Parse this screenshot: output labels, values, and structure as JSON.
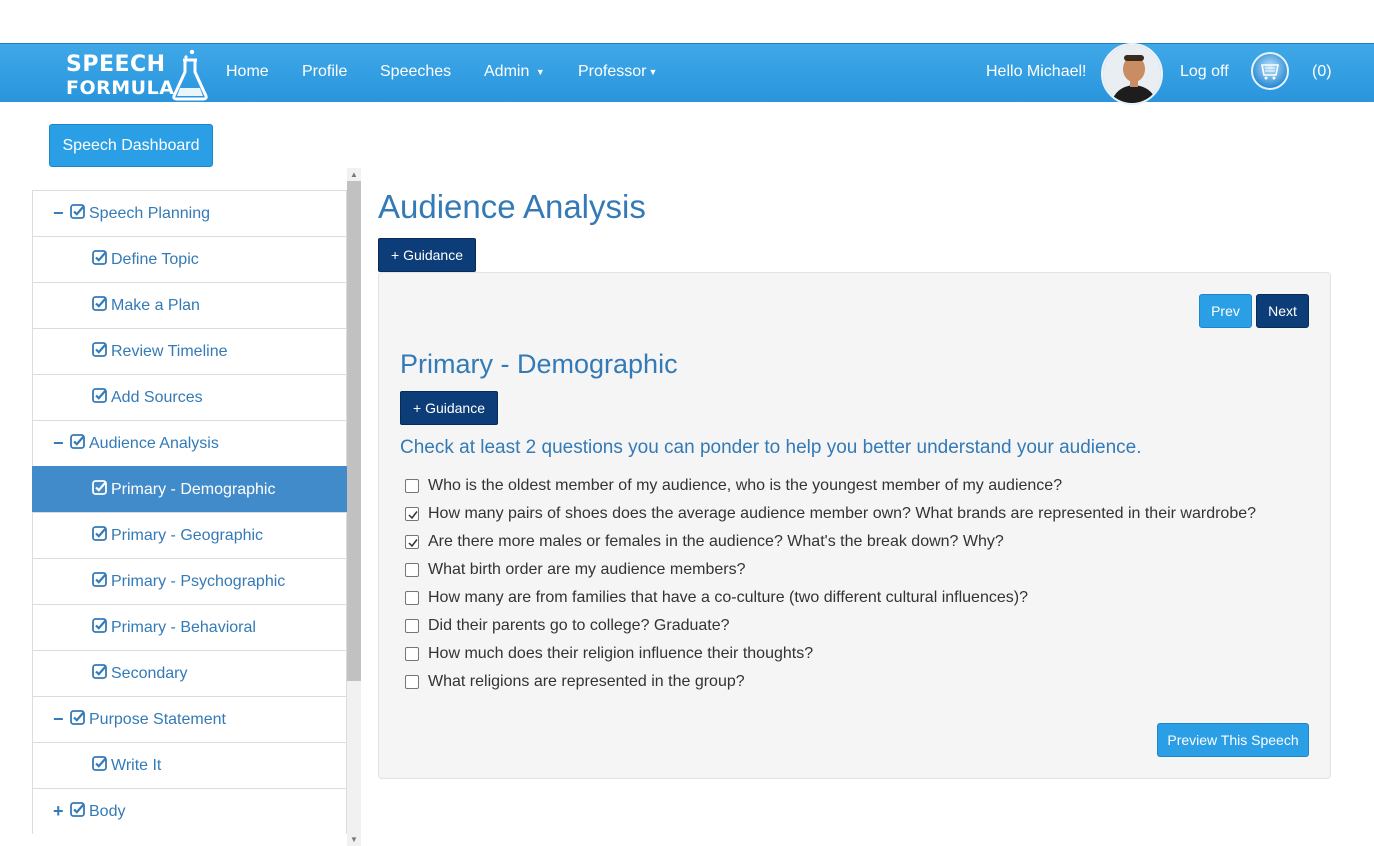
{
  "navbar": {
    "logo_line1": "SPEECH",
    "logo_line2": "FORMULA",
    "links": [
      "Home",
      "Profile",
      "Speeches",
      "Admin",
      "Professor"
    ],
    "greeting": "Hello Michael!",
    "logoff": "Log off",
    "cart_count": "(0)"
  },
  "dashboard_button": "Speech Dashboard",
  "sidebar": {
    "items": [
      {
        "label": "Speech Planning",
        "toggle": "−"
      },
      {
        "label": "Define Topic"
      },
      {
        "label": "Make a Plan"
      },
      {
        "label": "Review Timeline"
      },
      {
        "label": "Add Sources"
      },
      {
        "label": "Audience Analysis",
        "toggle": "−"
      },
      {
        "label": "Primary - Demographic",
        "active": true
      },
      {
        "label": "Primary - Geographic"
      },
      {
        "label": "Primary - Psychographic"
      },
      {
        "label": "Primary - Behavioral"
      },
      {
        "label": "Secondary"
      },
      {
        "label": "Purpose Statement",
        "toggle": "−"
      },
      {
        "label": "Write It"
      },
      {
        "label": "Body",
        "toggle": "+"
      }
    ]
  },
  "main": {
    "title": "Audience Analysis",
    "guidance_label": "+ Guidance",
    "prev_label": "Prev",
    "next_label": "Next",
    "section_title": "Primary - Demographic",
    "section_guidance_label": "+ Guidance",
    "instruction": "Check at least 2 questions you can ponder to help you better understand your audience.",
    "questions": [
      {
        "text": "Who is the oldest member of my audience, who is the youngest member of my audience?",
        "checked": false
      },
      {
        "text": "How many pairs of shoes does the average audience member own? What brands are represented in their wardrobe?",
        "checked": true
      },
      {
        "text": "Are there more males or females in the audience? What's the break down? Why?",
        "checked": true
      },
      {
        "text": "What birth order are my audience members?",
        "checked": false
      },
      {
        "text": "How many are from families that have a co-culture (two different cultural influences)?",
        "checked": false
      },
      {
        "text": "Did their parents go to college? Graduate?",
        "checked": false
      },
      {
        "text": "How much does their religion influence their thoughts?",
        "checked": false
      },
      {
        "text": "What religions are represented in the group?",
        "checked": false
      }
    ],
    "preview_label": "Preview This Speech"
  },
  "colors": {
    "nav_blue": "#2a95dc",
    "link_blue": "#337ab7",
    "dark_button": "#0d3d78",
    "light_button": "#2b9fe6",
    "active_item": "#428bca"
  }
}
